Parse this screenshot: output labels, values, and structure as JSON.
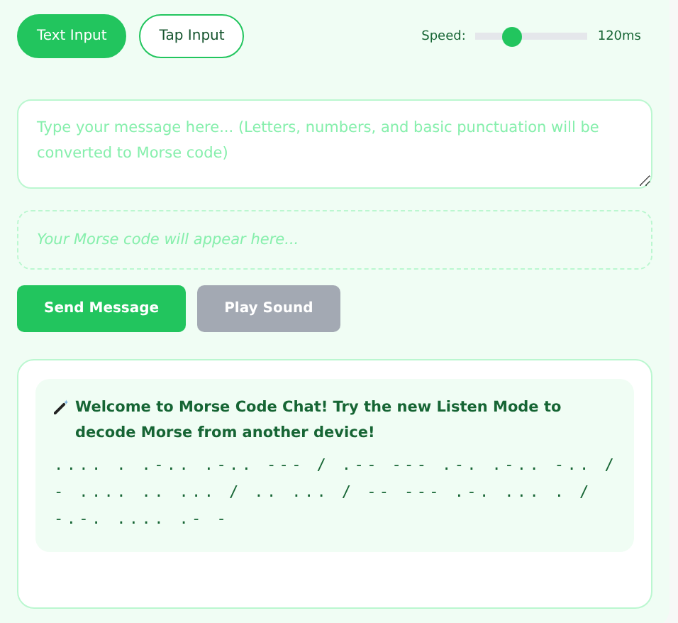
{
  "modes": [
    {
      "label": "Text Input",
      "selected": true
    },
    {
      "label": "Tap Input",
      "selected": false
    }
  ],
  "speed": {
    "label": "Speed:",
    "level": 0.32,
    "reading": "120ms"
  },
  "message_input": {
    "placeholder": "Type your message here... (Letters, numbers, and basic punctuation will be converted to Morse code)"
  },
  "morse_output": {
    "placeholder": "Your Morse code will appear here..."
  },
  "buttons": [
    {
      "label": "Send Message",
      "disabled": false
    },
    {
      "label": "Play Sound",
      "disabled": true
    }
  ],
  "messages": [
    {
      "text": "Welcome to Morse Code Chat! Try the new Listen Mode to decode Morse from another device!",
      "morse": ".... . .-.. .-.. --- / .-- --- .-. .-.. -.. / - .... .. ... / .. ... / -- --- .-. ... . / -.-. .... .- -"
    }
  ]
}
